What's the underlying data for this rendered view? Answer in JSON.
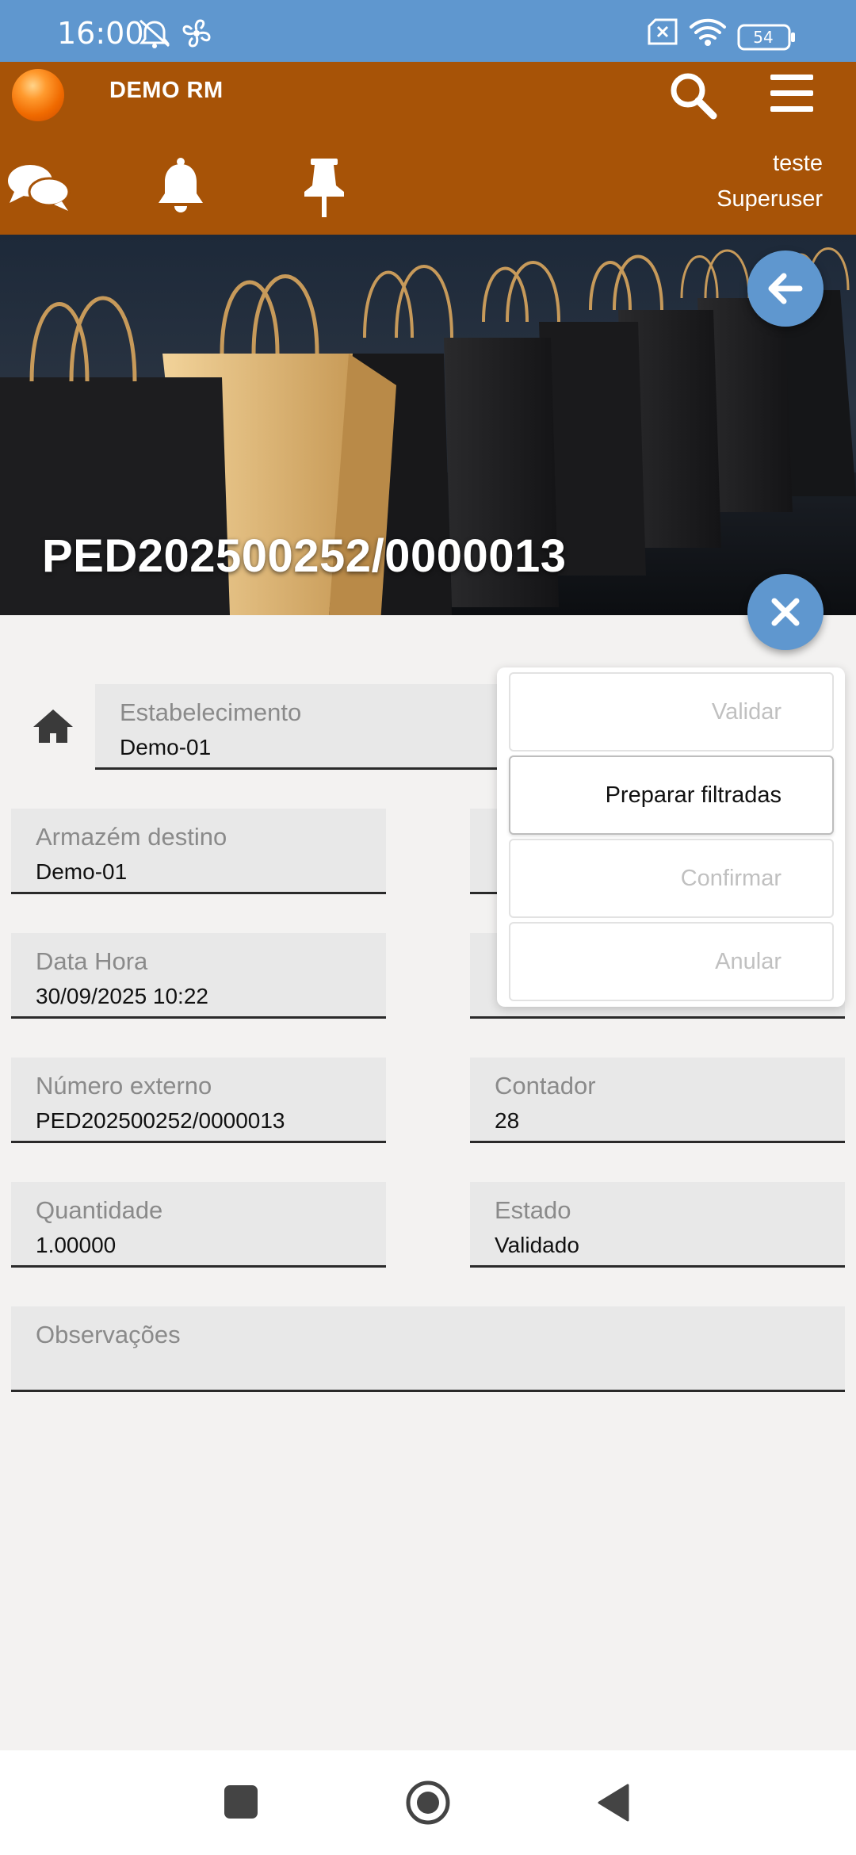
{
  "status_bar": {
    "time": "16:00",
    "battery": "54",
    "icons": [
      "alarm-off-icon",
      "fan-icon",
      "sim-off-icon",
      "wifi-icon",
      "battery-icon"
    ]
  },
  "header": {
    "app_title": "DEMO RM",
    "user_name": "teste",
    "user_role": "Superuser",
    "icons": [
      "search-icon",
      "menu-icon",
      "chat-icon",
      "bell-icon",
      "pin-icon"
    ]
  },
  "banner": {
    "title": "PED202500252/0000013"
  },
  "form": {
    "estabelecimento": {
      "label": "Estabelecimento",
      "value": "Demo-01"
    },
    "armazem_destino": {
      "label": "Armazém destino",
      "value": "Demo-01"
    },
    "data_hora": {
      "label": "Data Hora",
      "value": "30/09/2025 10:22"
    },
    "numero_externo": {
      "label": "Número externo",
      "value": "PED202500252/0000013"
    },
    "contador": {
      "label": "Contador",
      "value": "28"
    },
    "quantidade": {
      "label": "Quantidade",
      "value": "1.00000"
    },
    "estado": {
      "label": "Estado",
      "value": "Validado"
    },
    "observacoes": {
      "label": "Observações",
      "value": ""
    }
  },
  "menu": {
    "items": [
      {
        "label": "Validar",
        "enabled": false
      },
      {
        "label": "Preparar filtradas",
        "enabled": true
      },
      {
        "label": "Confirmar",
        "enabled": false
      },
      {
        "label": "Anular",
        "enabled": false
      }
    ]
  },
  "colors": {
    "status_bar": "#5f97cf",
    "header": "#a75307",
    "fab": "#5f97cf",
    "background": "#f3f2f1"
  }
}
